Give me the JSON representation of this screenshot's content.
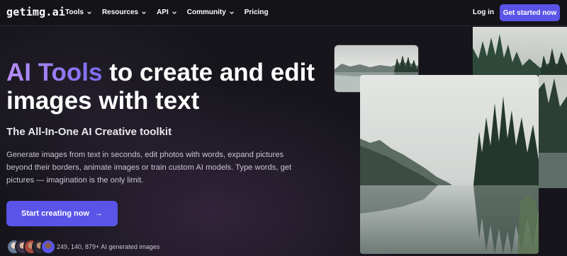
{
  "header": {
    "logo": "getimg.ai",
    "nav": [
      {
        "label": "Tools",
        "has_dropdown": true
      },
      {
        "label": "Resources",
        "has_dropdown": true
      },
      {
        "label": "API",
        "has_dropdown": true
      },
      {
        "label": "Community",
        "has_dropdown": true
      },
      {
        "label": "Pricing",
        "has_dropdown": false
      }
    ],
    "login_label": "Log in",
    "get_started_label": "Get started now"
  },
  "hero": {
    "title_accent": "AI Tools",
    "title_rest": " to create and edit images with text",
    "subtitle": "The All-In-One AI Creative toolkit",
    "description": "Generate images from text in seconds, edit photos with words, expand pictures beyond their borders, animate images or train custom AI models. Type words, get pictures — imagination is the only limit.",
    "cta_label": "Start creating now",
    "cta_arrow": "→",
    "generated_count": "249, 140, 879+ AI generated images"
  },
  "colors": {
    "accent": "#5a54e8",
    "background": "#16151b",
    "title_gradient_start": "#b88df4",
    "title_gradient_end": "#7a6bf0"
  },
  "icons": {
    "nav_dropdown": "chevron-down-icon",
    "cta": "arrow-right-icon"
  }
}
